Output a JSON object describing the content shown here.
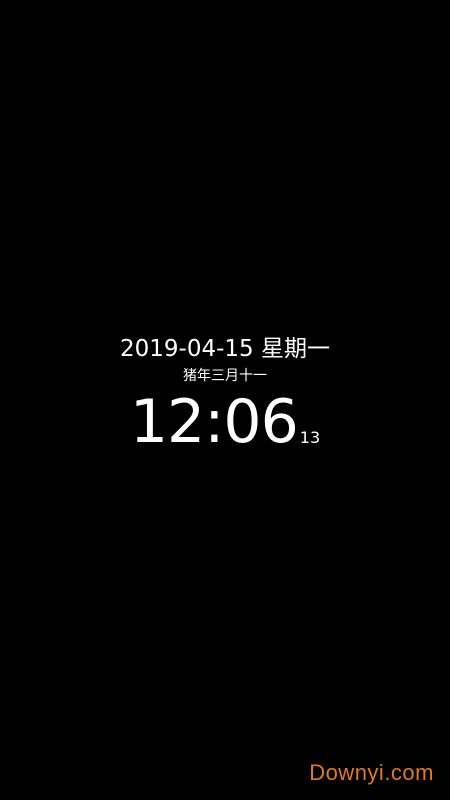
{
  "lockscreen": {
    "date": "2019-04-15",
    "weekday": "星期一",
    "lunar_date": "猪年三月十一",
    "time": "12:06",
    "seconds": "13"
  },
  "watermark": {
    "text": "Downyi.com",
    "color": "#e07a1c"
  },
  "colors": {
    "background": "#000000",
    "text": "#ffffff"
  }
}
